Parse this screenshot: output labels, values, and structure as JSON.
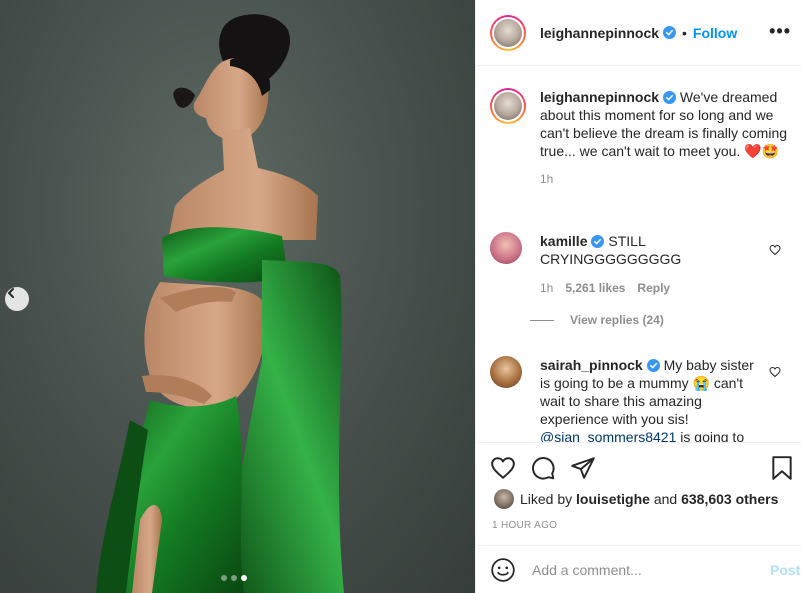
{
  "post": {
    "photo_alt": "",
    "carousel": {
      "count": 3,
      "active_index": 2
    }
  },
  "header": {
    "username": "leighannepinnock",
    "bullet": "•",
    "follow_label": "Follow",
    "more_label": "•••"
  },
  "caption": {
    "username": "leighannepinnock",
    "text": "We've dreamed about this moment for so long and we can't believe the dream is finally coming true... we can't wait to meet you.",
    "emojis": "❤️🤩",
    "time": "1h"
  },
  "comments": [
    {
      "username": "kamille",
      "text": "STILL CRYINGGGGGGGGG",
      "time": "1h",
      "likes": "5,261 likes",
      "reply_label": "Reply",
      "view_replies": "View replies (24)"
    },
    {
      "username": "sairah_pinnock",
      "text_before": "My baby sister is going to be a mummy",
      "emoji": "😭",
      "text_after": "can't wait to share this amazing experience with you sis!",
      "mention": "@sian_sommers8421",
      "text_tail": "is going to"
    }
  ],
  "likes": {
    "prefix": "Liked by",
    "liker": "louisetighe",
    "middle": "and",
    "others": "638,603 others"
  },
  "timestamp": "1 HOUR AGO",
  "add_comment": {
    "placeholder": "Add a comment...",
    "post_label": "Post"
  },
  "colors": {
    "accent": "#0095f6",
    "post_disabled": "#b2dffc",
    "text": "#262626",
    "muted": "#8e8e8e",
    "dress_green": "#1f8a2a"
  }
}
